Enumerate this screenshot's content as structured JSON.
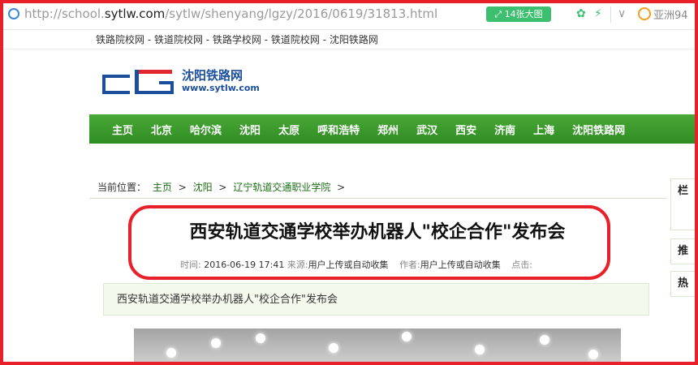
{
  "browser": {
    "url_prefix": "http://school.",
    "url_domain": "sytlw.com",
    "url_path": "/sytlw/shenyang/lgzy/2016/0619/31813.html",
    "images_button": "14张大图",
    "search_text": "亚洲94"
  },
  "top_links": "铁路院校网 - 铁道院校网 - 铁路学校网 - 铁道院校网 - 沈阳铁路网",
  "logo": {
    "name": "沈阳铁路网",
    "site": "www.sytlw.com"
  },
  "nav": [
    "主页",
    "北京",
    "哈尔滨",
    "沈阳",
    "太原",
    "呼和浩特",
    "郑州",
    "武汉",
    "西安",
    "济南",
    "上海",
    "沈阳铁路网"
  ],
  "breadcrumb": {
    "label": "当前位置：",
    "items": [
      "主页",
      "沈阳",
      "辽宁轨道交通职业学院"
    ],
    "sep": ">"
  },
  "article": {
    "title": "西安轨道交通学校举办机器人\"校企合作\"发布会",
    "time_label": "时间:",
    "time": "2016-06-19 17:41",
    "source_label": "来源:",
    "source": "用户上传或自动收集",
    "author_label": "作者:",
    "author": "用户上传或自动收集",
    "clicks_label": "点击:",
    "summary": "西安轨道交通学校举办机器人\"校企合作\"发布会"
  },
  "sidebar": [
    "栏",
    "推",
    "热"
  ]
}
